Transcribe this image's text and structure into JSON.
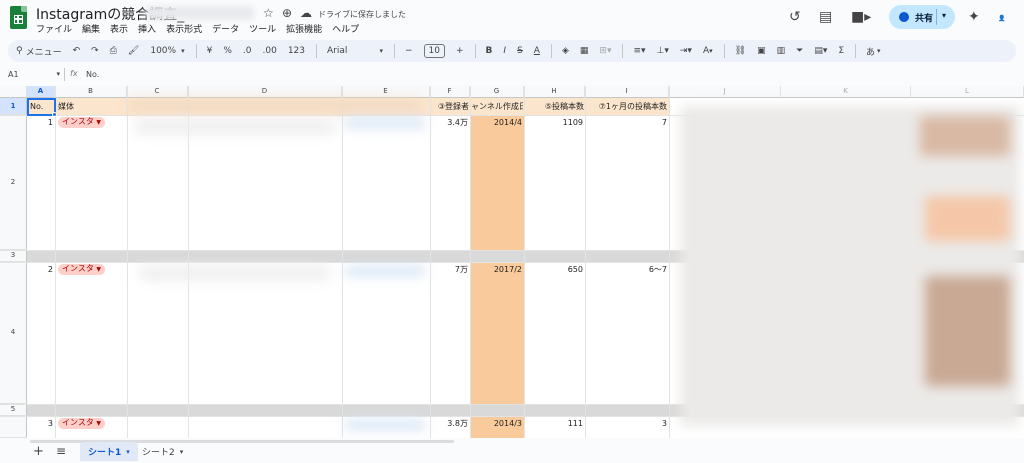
{
  "title": {
    "name": "Instagramの競合調査_",
    "saved_status": "ドライブに保存しました",
    "star_icon": "star-icon",
    "move_icon": "folder-move-icon",
    "cloud_icon": "cloud-done-icon"
  },
  "menu": [
    "ファイル",
    "編集",
    "表示",
    "挿入",
    "表示形式",
    "データ",
    "ツール",
    "拡張機能",
    "ヘルプ"
  ],
  "share": {
    "label": "共有"
  },
  "toolbar": {
    "search_menu": "メニュー",
    "zoom": "100%",
    "currency": "¥",
    "percent": "%",
    "decrease_decimal": ".0",
    "increase_decimal": ".00",
    "number_format": "123",
    "font": "Arial",
    "font_size": "10",
    "bold": "B",
    "italic": "I",
    "strike": "S",
    "text_color": "A",
    "rotate": "A",
    "input_tools": "あ"
  },
  "formula": {
    "cell_ref": "A1",
    "fx": "fx",
    "value": "No."
  },
  "columns": [
    "A",
    "B",
    "C",
    "D",
    "E",
    "F",
    "G",
    "H",
    "I",
    "J",
    "K",
    "L"
  ],
  "rows": [
    "1",
    "2",
    "3",
    "4",
    "5"
  ],
  "header": {
    "a": "No.",
    "b": "媒体",
    "f": "③登録者",
    "g": "ャンネル作成日",
    "h": "⑤投稿本数",
    "i": "⑦1ヶ月の投稿本数"
  },
  "data": [
    {
      "no": "1",
      "media": "インスタ",
      "followers": "3.4万",
      "created": "2014/4",
      "posts": "1109",
      "monthly": "7"
    },
    {
      "no": "2",
      "media": "インスタ",
      "followers": "7万",
      "created": "2017/2",
      "posts": "650",
      "monthly": "6〜7"
    },
    {
      "no": "3",
      "media": "インスタ",
      "followers": "3.8万",
      "created": "2014/3",
      "posts": "111",
      "monthly": "3"
    }
  ],
  "sheets": [
    "シート1",
    "シート2"
  ],
  "colors": {
    "header_fill": "#fce5cd",
    "date_fill": "#f9cb9c",
    "chip_fill": "#ffcfc9",
    "chip_text": "#b10202",
    "share_fill": "#c2e7ff",
    "selection": "#1a73e8"
  }
}
